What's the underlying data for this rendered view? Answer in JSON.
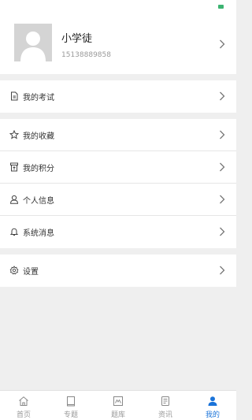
{
  "profile": {
    "name": "小学徒",
    "phone": "15138889858"
  },
  "menu": {
    "exam": "我的考试",
    "favorites": "我的收藏",
    "points": "我的积分",
    "personal_info": "个人信息",
    "system_messages": "系统消息",
    "settings": "设置"
  },
  "tabs": [
    {
      "label": "首页",
      "icon": "home-icon"
    },
    {
      "label": "专题",
      "icon": "book-icon"
    },
    {
      "label": "题库",
      "icon": "question-bank-icon"
    },
    {
      "label": "资讯",
      "icon": "news-icon"
    },
    {
      "label": "我的",
      "icon": "user-icon"
    }
  ],
  "colors": {
    "accent": "#1a73d9",
    "background": "#efefef",
    "battery": "#3cb371"
  }
}
